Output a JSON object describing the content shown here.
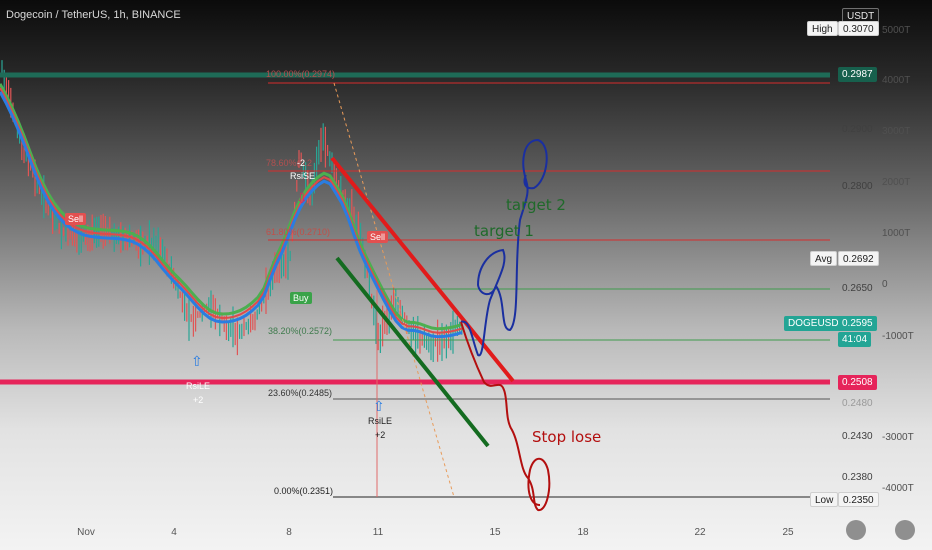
{
  "header": {
    "title": "Dogecoin / TetherUS, 1h, BINANCE"
  },
  "currency_label": "USDT",
  "price_axis": {
    "ticks": [
      "0.2900",
      "0.2800",
      "0.2650",
      "0.2430",
      "0.2380"
    ]
  },
  "volume_axis": {
    "ticks": [
      "5000T",
      "4000T",
      "3000T",
      "2000T",
      "1000T",
      "0",
      "-1000T",
      "-3000T",
      "-4000T"
    ]
  },
  "x_axis": {
    "ticks": [
      "Nov",
      "4",
      "8",
      "11",
      "15",
      "18",
      "22",
      "25"
    ]
  },
  "price_tags": {
    "high_label": "High",
    "high_value": "0.3070",
    "resistance_value": "0.2987",
    "avg_label": "Avg",
    "avg_value": "0.2692",
    "symbol_label": "DOGEUSDT",
    "symbol_value": "0.2595",
    "countdown": "41:04",
    "support_value": "0.2508",
    "low_label": "Low",
    "low_value": "0.2350",
    "faint_value": "0.2480"
  },
  "fib_levels": {
    "f100": "100.00%(0.2974)",
    "f786": "78.60%(0.2",
    "f618": "61.80%(0.2710)",
    "f382": "38.20%(0.2572)",
    "f236": "23.60%(0.2485)",
    "f0": "0.00%(0.2351)"
  },
  "markers": {
    "sell_1": "Sell",
    "sell_2": "Sell",
    "buy_1": "Buy",
    "rsi_se_count": "-2",
    "rsi_se": "RsiSE",
    "rsi_le_1": "RsiLE",
    "rsi_le_1_count": "+2",
    "rsi_le_2": "RsiLE",
    "rsi_le_2_count": "+2"
  },
  "annotations": {
    "target_1": "target 1",
    "target_2": "target 2",
    "stop_lose": "Stop lose"
  },
  "colors": {
    "resistance": "#1e6b57",
    "support": "#e6245a",
    "fib_red": "#d62c2c",
    "fib_green": "#3f9b4d",
    "wedge_red": "#e11b1b",
    "wedge_green": "#146b20",
    "ma_blue": "#2a7de1",
    "ma_green": "#4caf50",
    "hand_blue": "#1a2fa0",
    "hand_red": "#b30f0f"
  }
}
